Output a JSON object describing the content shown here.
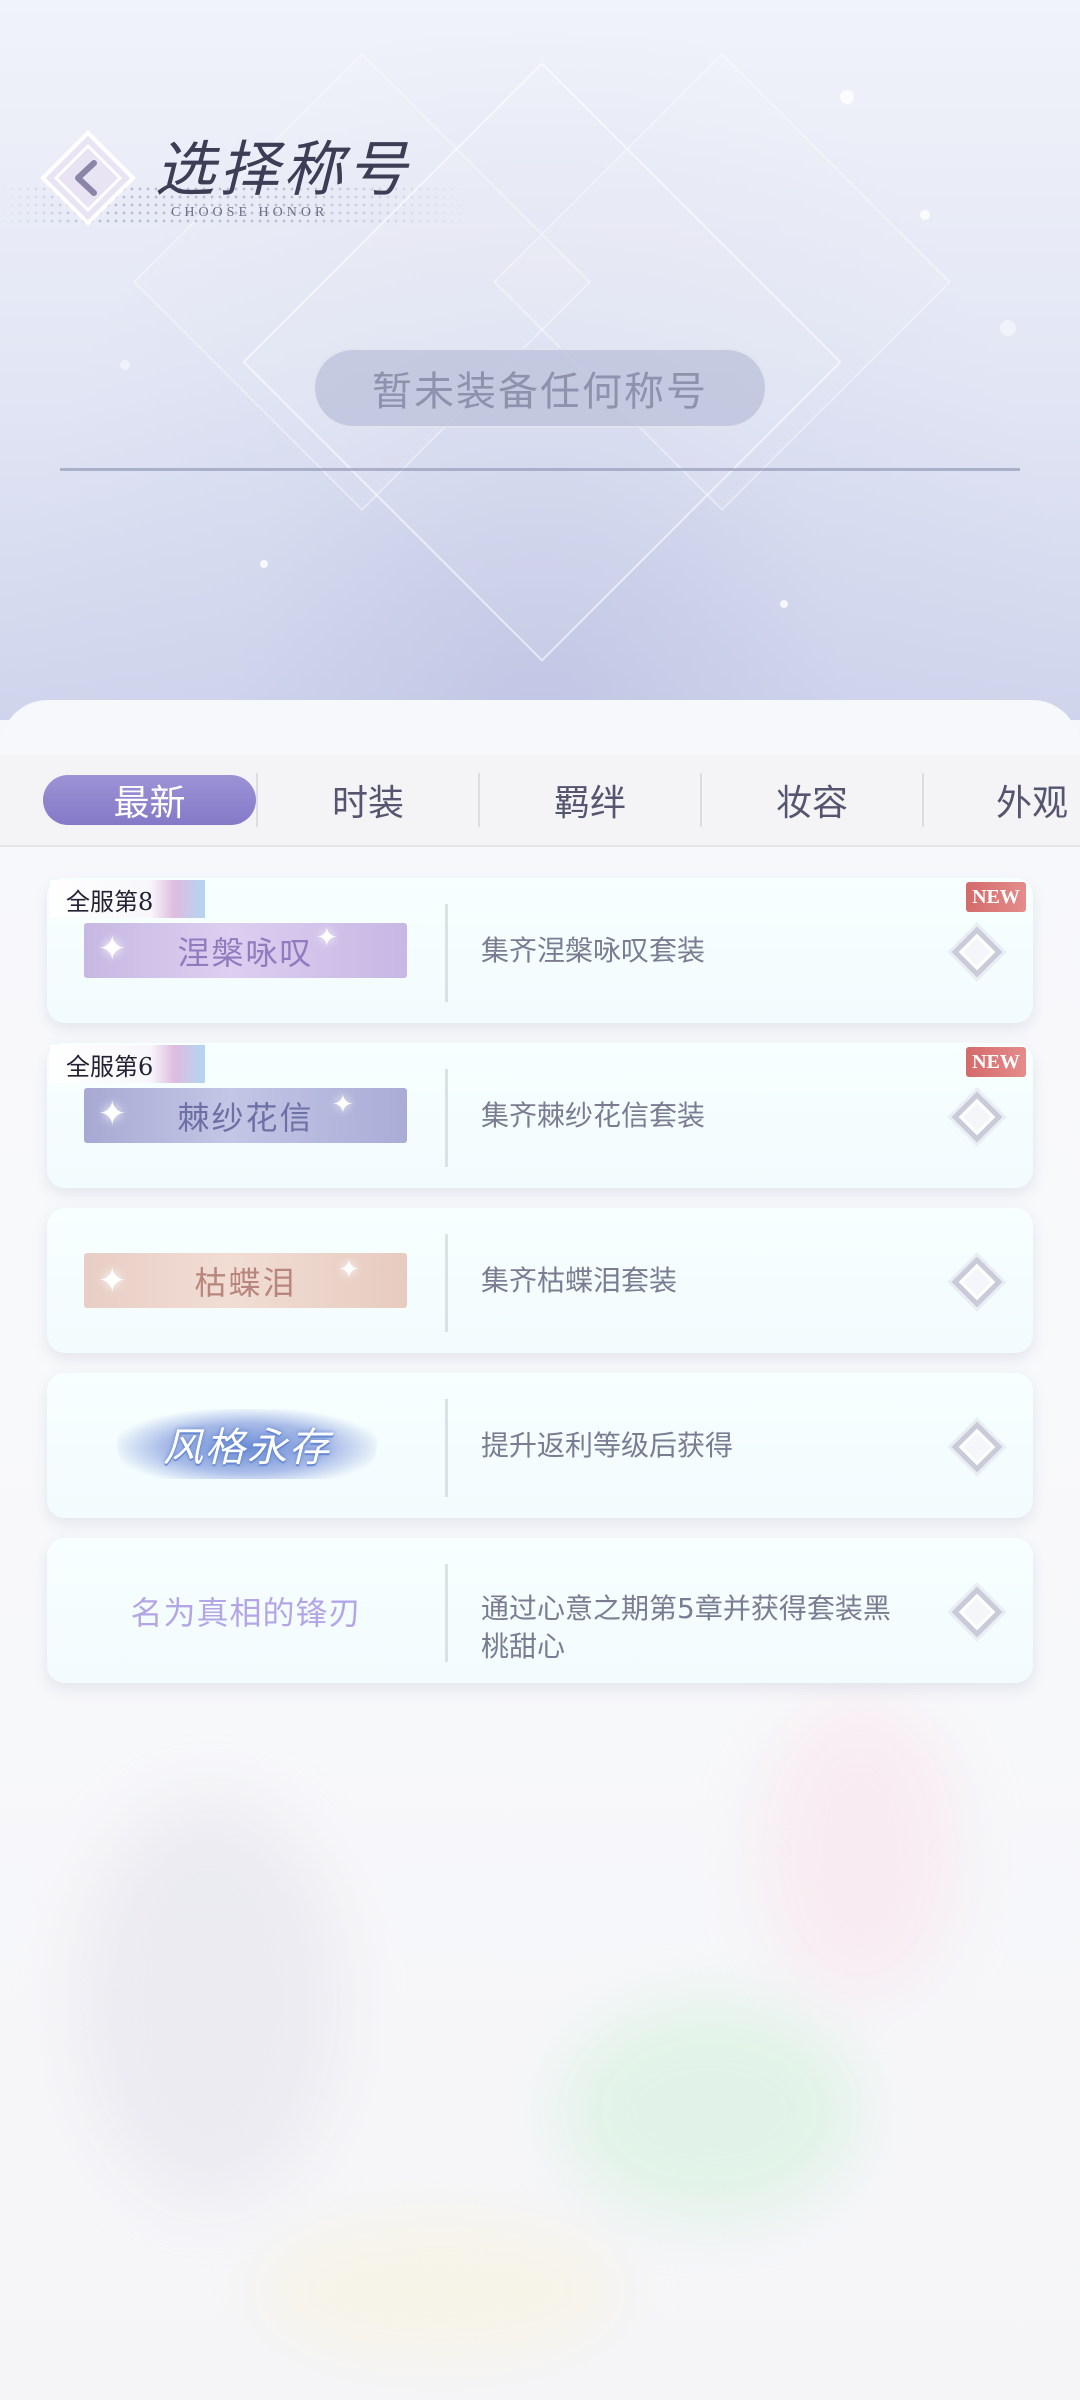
{
  "header": {
    "title": "选择称号",
    "subtitle": "CHOOSE HONOR",
    "equipped_status": "暂未装备任何称号"
  },
  "tabs": [
    {
      "label": "最新",
      "active": true
    },
    {
      "label": "时装",
      "active": false
    },
    {
      "label": "羁绊",
      "active": false
    },
    {
      "label": "妆容",
      "active": false
    },
    {
      "label": "外观",
      "active": false
    }
  ],
  "titles": [
    {
      "name": "涅槃咏叹",
      "rank": "全服第8",
      "is_new": true,
      "new_label": "NEW",
      "style": "purple",
      "requirement": "集齐涅槃咏叹套装"
    },
    {
      "name": "棘纱花信",
      "rank": "全服第6",
      "is_new": true,
      "new_label": "NEW",
      "style": "blue",
      "requirement": "集齐棘纱花信套装"
    },
    {
      "name": "枯蝶泪",
      "rank": "",
      "is_new": false,
      "style": "peach",
      "requirement": "集齐枯蝶泪套装"
    },
    {
      "name": "风格永存",
      "rank": "",
      "is_new": false,
      "style": "logo",
      "requirement": "提升返利等级后获得"
    },
    {
      "name": "名为真相的锋刃",
      "rank": "",
      "is_new": false,
      "style": "plain",
      "requirement": "通过心意之期第5章并获得套装黑桃甜心"
    }
  ],
  "colors": {
    "accent": "#8a80cc",
    "text": "#555570",
    "new_badge": "#d46a6a"
  }
}
